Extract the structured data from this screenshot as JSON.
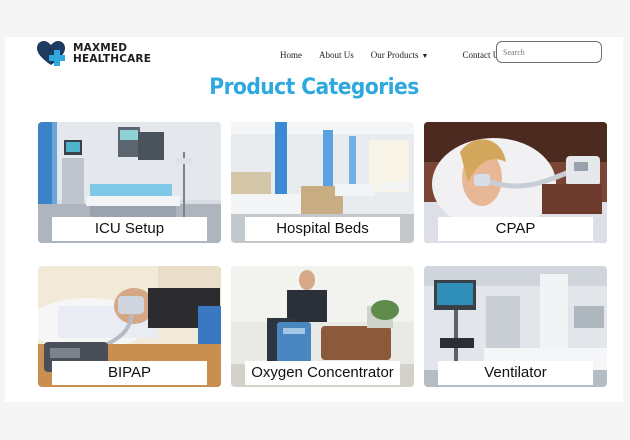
{
  "brand": {
    "line1": "MAXMED",
    "line2": "HEALTHCARE",
    "colors": {
      "heart": "#1e3a5f",
      "cross": "#2fa8df"
    }
  },
  "nav": {
    "items": [
      "Home",
      "About Us",
      "Our Products",
      "Contact Us"
    ],
    "dropdown_icon": "caret-down-icon"
  },
  "search": {
    "placeholder": "Search",
    "value": ""
  },
  "heading": {
    "title": "Product Categories",
    "color": "#2fa8df"
  },
  "categories": [
    {
      "name": "ICU Setup",
      "image": "icu-room-photo"
    },
    {
      "name": "Hospital Beds",
      "image": "hospital-ward-photo"
    },
    {
      "name": "CPAP",
      "image": "cpap-sleeper-photo"
    },
    {
      "name": "BIPAP",
      "image": "bipap-sleeper-photo"
    },
    {
      "name": "Oxygen Concentrator",
      "image": "oxygen-concentrator-photo"
    },
    {
      "name": "Ventilator",
      "image": "ventilator-photo"
    }
  ]
}
